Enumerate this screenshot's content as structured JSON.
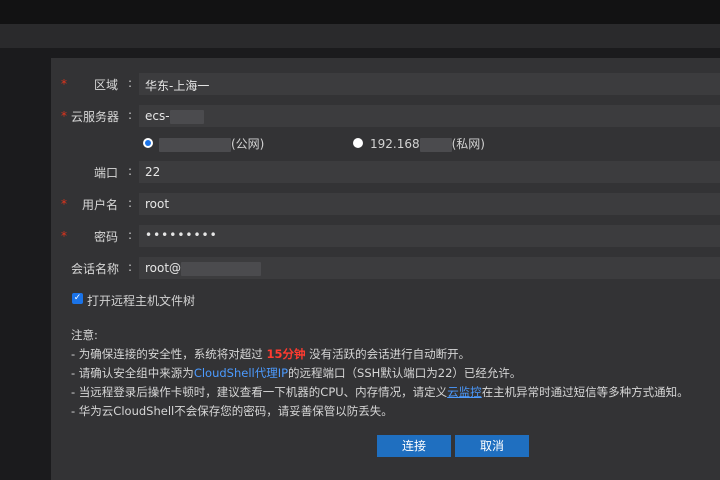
{
  "form": {
    "region": {
      "label": "区域",
      "value": "华东-上海一",
      "required": true
    },
    "server": {
      "label": "云服务器",
      "value_prefix": "ecs-",
      "required": true,
      "public_suffix": "(公网)",
      "private_prefix": "192.168",
      "private_suffix": "(私网)"
    },
    "port": {
      "label": "端口",
      "value": "22"
    },
    "username": {
      "label": "用户名",
      "value": "root",
      "required": true
    },
    "password": {
      "label": "密码",
      "value": "•••••••••",
      "required": true
    },
    "session": {
      "label": "会话名称",
      "value_prefix": "root@"
    },
    "colon": ":",
    "required_mark": "*"
  },
  "checkbox": {
    "label": "打开远程主机文件树",
    "checked": true
  },
  "notes": {
    "title": "注意:",
    "line1_a": "- 为确保连接的安全性，系统将对超过 ",
    "line1_b": "15分钟",
    "line1_c": " 没有活跃的会话进行自动断开。",
    "line2_a": "- 请确认安全组中来源为",
    "line2_b": "CloudShell代理IP",
    "line2_c": "的远程端口（SSH默认端口为22）已经允许。",
    "line3_a": "- 当远程登录后操作卡顿时，建议查看一下机器的CPU、内存情况，请定义",
    "line3_b": "云监控",
    "line3_c": "在主机异常时通过短信等多种方式通知。",
    "line4": "- 华为云CloudShell不会保存您的密码，请妥善保管以防丢失。"
  },
  "buttons": {
    "connect": "连接",
    "cancel": "取消"
  },
  "colors": {
    "primary": "#1f6fc0",
    "danger": "#ff3b30",
    "link": "#4c9bff"
  }
}
